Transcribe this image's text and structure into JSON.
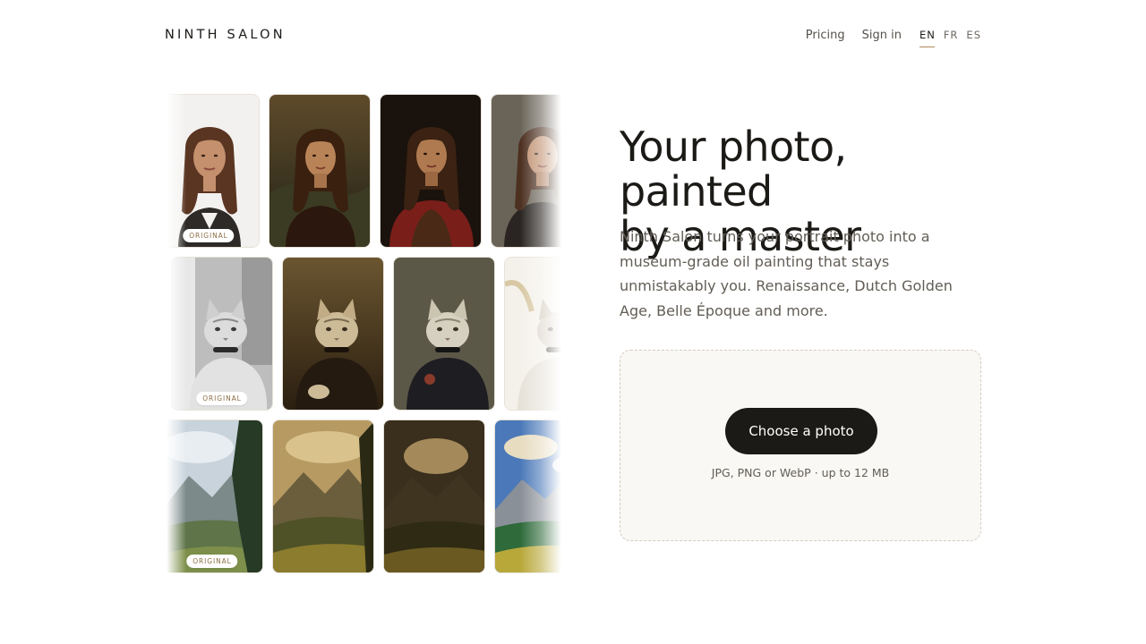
{
  "brand": "NINTH SALON",
  "nav": {
    "pricing": "Pricing",
    "sign_in": "Sign in",
    "languages": [
      "EN",
      "FR",
      "ES"
    ],
    "active_language": "EN"
  },
  "gallery": {
    "badge": "ORIGINAL",
    "rows": [
      {
        "subject": "woman portrait",
        "tiles": [
          "original photo",
          "renaissance portrait",
          "dark baroque portrait",
          "soft painted portrait"
        ]
      },
      {
        "subject": "cat portrait",
        "tiles": [
          "original photo",
          "renaissance portrait",
          "dutch golden age portrait",
          "watercolor portrait"
        ]
      },
      {
        "subject": "mountain landscape",
        "tiles": [
          "original photo",
          "golden landscape painting",
          "dramatic landscape painting",
          "impressionist landscape painting"
        ]
      }
    ]
  },
  "hero": {
    "title_line1": "Your photo, painted",
    "title_line2": "by a master",
    "description": "Ninth Salon turns your portrait photo into a museum-grade oil painting that stays unmistakably you. Renaissance, Dutch Golden Age, Belle Époque and more."
  },
  "upload": {
    "button_label": "Choose a photo",
    "hint": "JPG, PNG or WebP · up to 12 MB"
  },
  "colors": {
    "accent": "#b08a5a",
    "button": "#1c1a17",
    "text": "#1c1a17",
    "muted": "#625d56"
  }
}
